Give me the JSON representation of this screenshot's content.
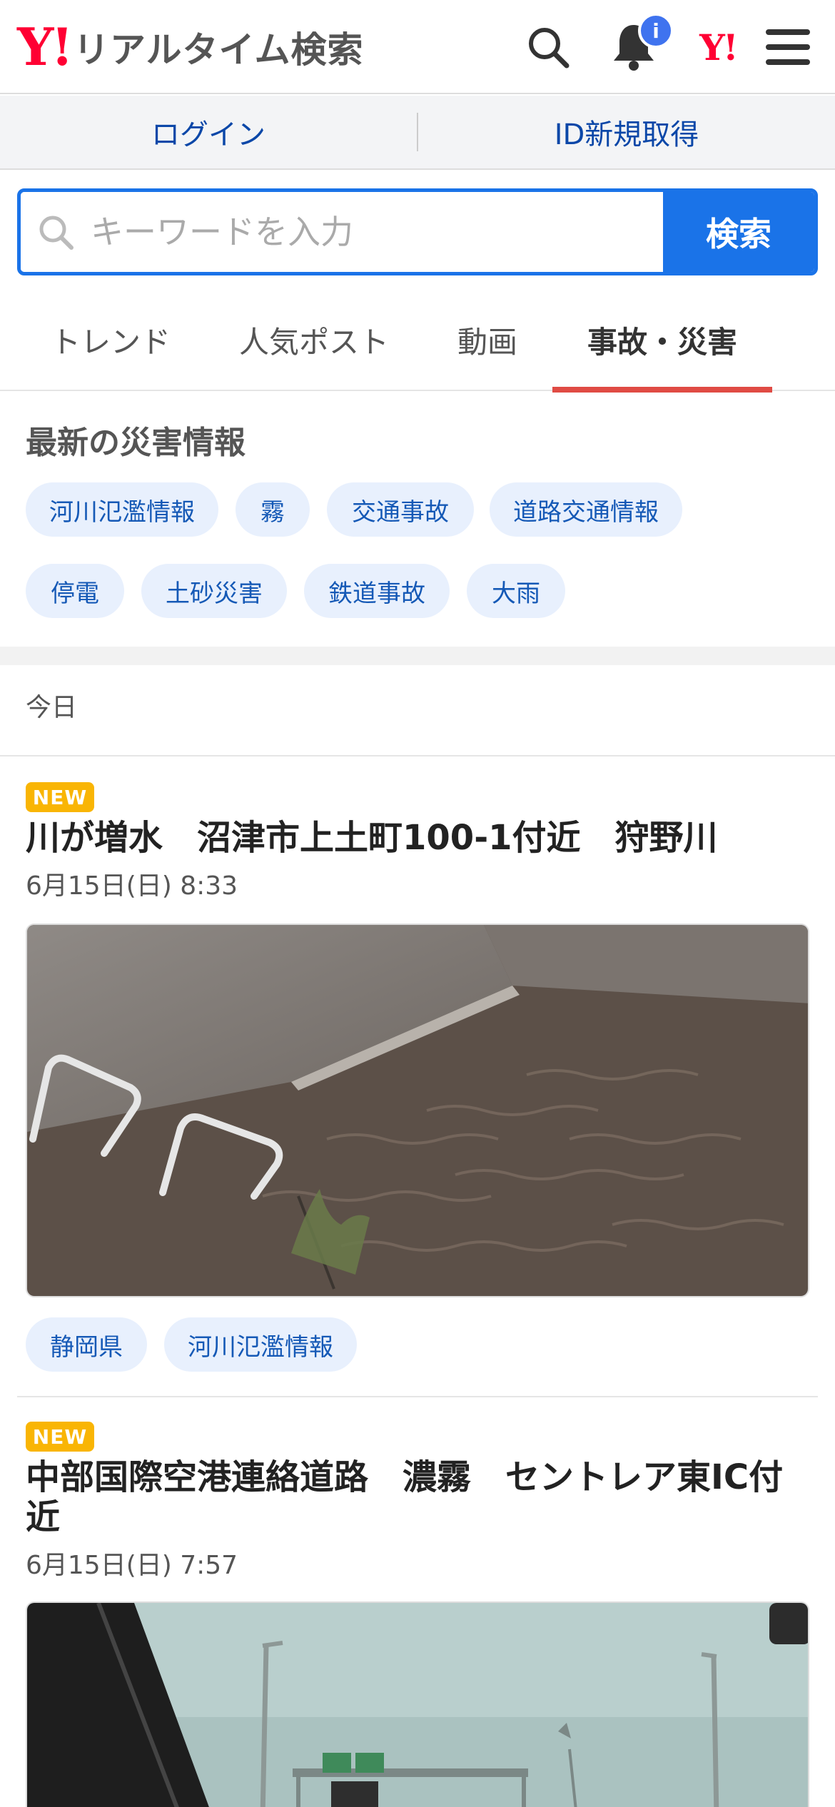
{
  "header": {
    "logo_mark": "Y!",
    "logo_text": "リアルタイム検索",
    "notification_badge": "i",
    "yahoo_mark": "Y!"
  },
  "auth": {
    "login": "ログイン",
    "register": "ID新規取得"
  },
  "search": {
    "placeholder": "キーワードを入力",
    "button": "検索"
  },
  "tabs": [
    {
      "label": "トレンド",
      "active": false
    },
    {
      "label": "人気ポスト",
      "active": false
    },
    {
      "label": "動画",
      "active": false
    },
    {
      "label": "事故・災害",
      "active": true
    }
  ],
  "disaster": {
    "title": "最新の災害情報",
    "categories": [
      "河川氾濫情報",
      "霧",
      "交通事故",
      "道路交通情報",
      "停電",
      "土砂災害",
      "鉄道事故",
      "大雨"
    ]
  },
  "feed": {
    "day_label": "今日",
    "posts": [
      {
        "badge": "NEW",
        "title": "川が増水　沼津市上土町100-1付近　狩野川",
        "date": "6月15日(日) 8:33",
        "image": "flooded-river-photo",
        "tags": [
          "静岡県",
          "河川氾濫情報"
        ]
      },
      {
        "badge": "NEW",
        "title": "中部国際空港連絡道路　濃霧　セントレア東IC付近",
        "date": "6月15日(日) 7:57",
        "image": "foggy-highway-photo",
        "tags": []
      }
    ]
  },
  "colors": {
    "accent": "#1a73e8",
    "tab_underline": "#e04b44",
    "new_badge": "#f9b504",
    "brand": "#ff0033"
  }
}
